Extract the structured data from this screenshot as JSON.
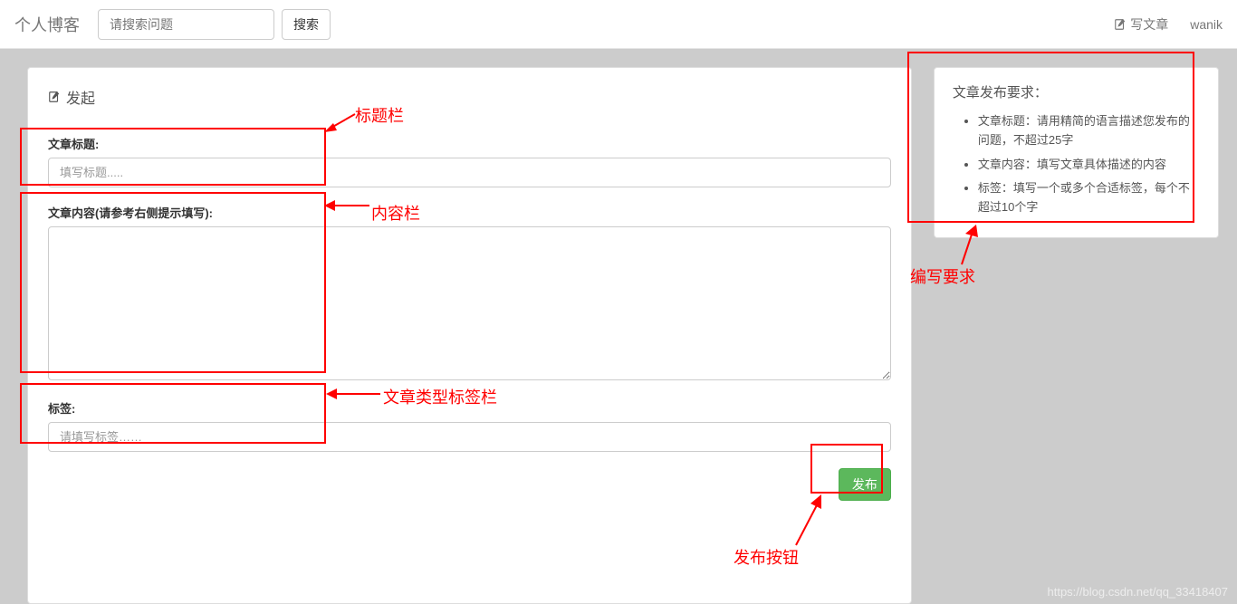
{
  "nav": {
    "brand": "个人博客",
    "search_placeholder": "请搜索问题",
    "search_btn": "搜索",
    "write_link": "写文章",
    "username": "wanik"
  },
  "panel": {
    "title": "发起",
    "title_label": "文章标题:",
    "title_placeholder": "填写标题.....",
    "content_label": "文章内容(请参考右侧提示填写):",
    "tag_label": "标签:",
    "tag_placeholder": "请填写标签……",
    "publish_btn": "发布"
  },
  "sidebar": {
    "title": "文章发布要求：",
    "items": [
      "文章标题：请用精简的语言描述您发布的问题，不超过25字",
      "文章内容：填写文章具体描述的内容",
      "标签：填写一个或多个合适标签，每个不超过10个字"
    ]
  },
  "annotations": {
    "title_bar": "标题栏",
    "content_bar": "内容栏",
    "tag_bar": "文章类型标签栏",
    "publish_btn": "发布按钮",
    "requirements": "编写要求"
  },
  "watermark": "https://blog.csdn.net/qq_33418407"
}
